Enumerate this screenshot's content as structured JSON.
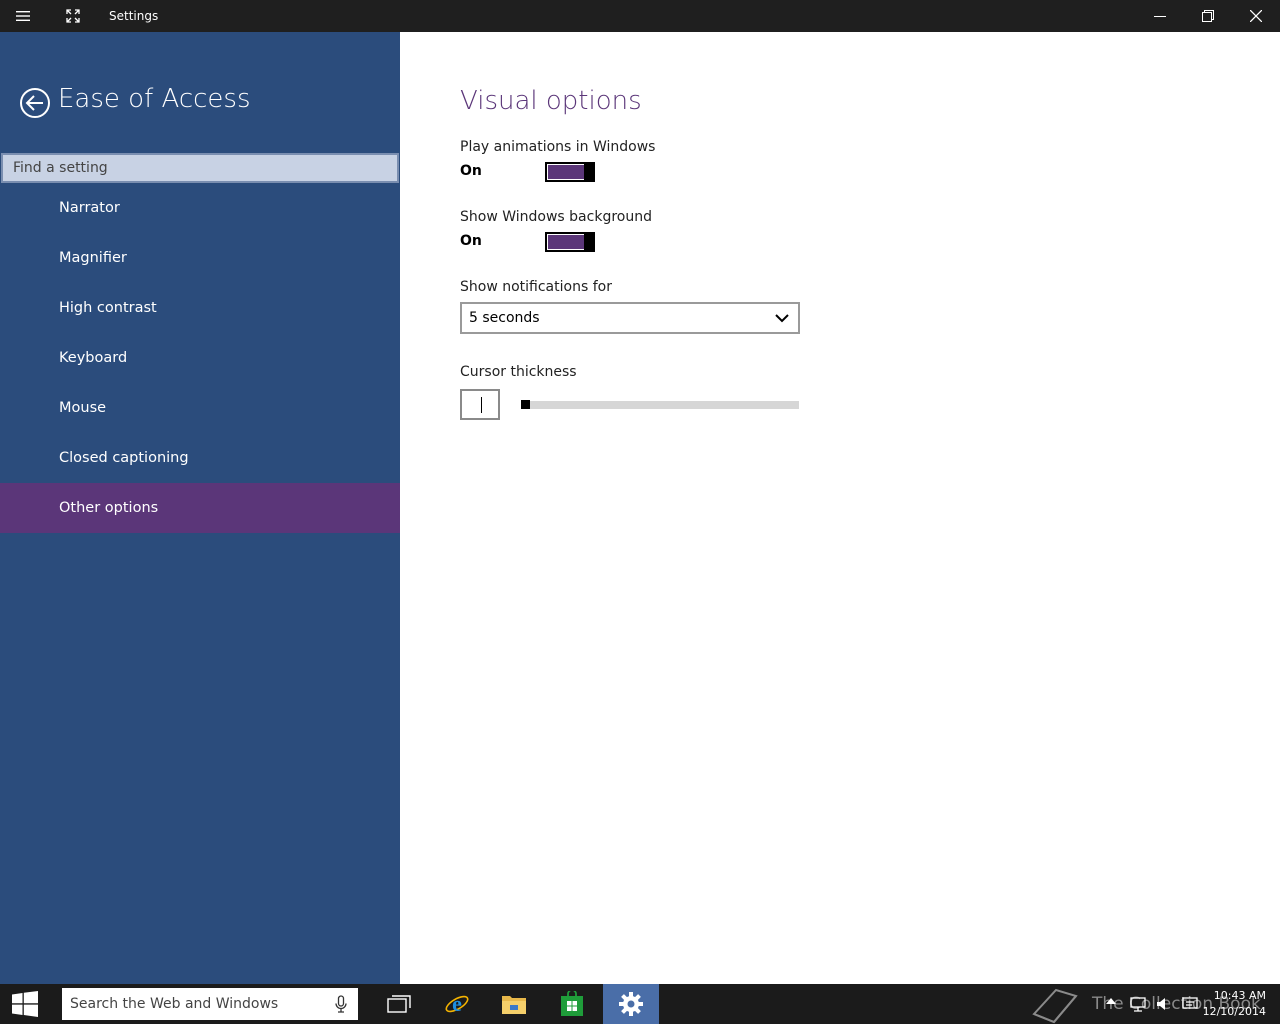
{
  "window": {
    "title": "Settings"
  },
  "sidebar": {
    "title": "Ease of Access",
    "search_placeholder": "Find a setting",
    "items": [
      {
        "label": "Narrator",
        "active": false
      },
      {
        "label": "Magnifier",
        "active": false
      },
      {
        "label": "High contrast",
        "active": false
      },
      {
        "label": "Keyboard",
        "active": false
      },
      {
        "label": "Mouse",
        "active": false
      },
      {
        "label": "Closed captioning",
        "active": false
      },
      {
        "label": "Other options",
        "active": true
      }
    ]
  },
  "main": {
    "heading": "Visual options",
    "play_animations": {
      "label": "Play animations in Windows",
      "state": "On"
    },
    "show_background": {
      "label": "Show Windows background",
      "state": "On"
    },
    "notifications": {
      "label": "Show notifications for",
      "selected": "5 seconds"
    },
    "cursor_thickness": {
      "label": "Cursor thickness",
      "value": 1
    }
  },
  "taskbar": {
    "search_placeholder": "Search the Web and Windows",
    "pinned": [
      "task-view-icon",
      "internet-explorer-icon",
      "file-explorer-icon",
      "store-icon",
      "settings-icon"
    ],
    "watermark": "The Collection Book",
    "time": "10:43 AM",
    "date": "12/10/2014"
  },
  "colors": {
    "sidebar_bg": "#2b4c7c",
    "accent": "#5b3679",
    "titlebar_bg": "#1f1f1f",
    "taskbar_bg": "#1b1b1b"
  }
}
